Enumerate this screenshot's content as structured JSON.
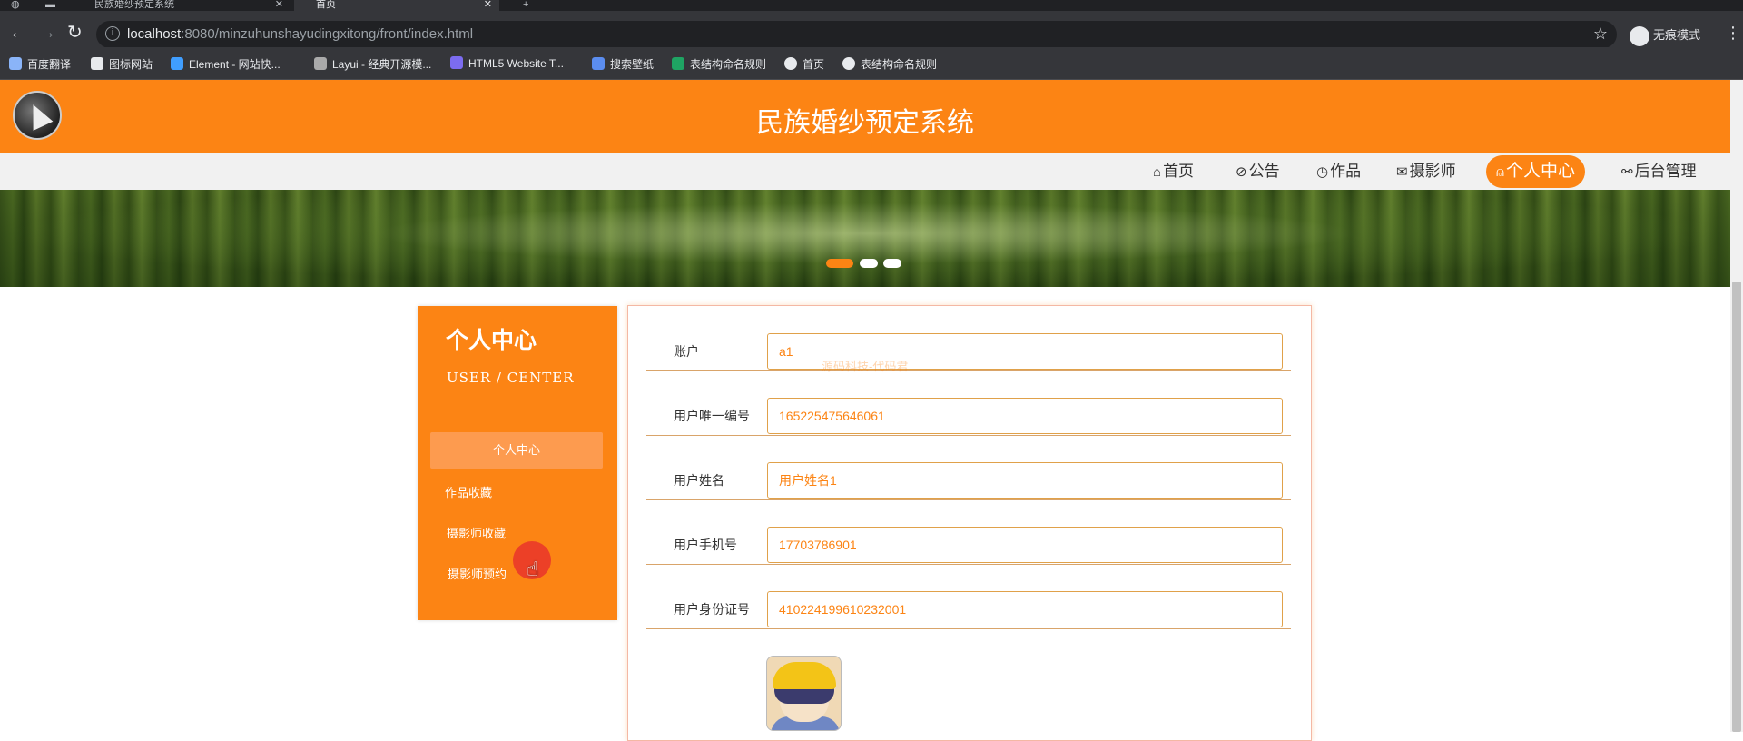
{
  "browser": {
    "tabs": [
      {
        "label": "",
        "active": false
      },
      {
        "label": "民族婚纱预定系统",
        "active": false
      },
      {
        "label": "首页",
        "active": true
      }
    ],
    "new_tab": "+",
    "url_host": "localhost",
    "url_rest": ":8080/minzuhunshayudingxitong/front/index.html",
    "incognito_label": "无痕模式",
    "bookmarks": [
      "百度翻译",
      "图标网站",
      "Element - 网站快...",
      "Layui - 经典开源模...",
      "HTML5 Website T...",
      "搜索壁纸",
      "表结构命名规则",
      "首页",
      "表结构命名规则"
    ]
  },
  "site": {
    "title": "民族婚纱预定系统",
    "nav": [
      {
        "icon": "⌂",
        "label": "首页"
      },
      {
        "icon": "⊘",
        "label": "公告"
      },
      {
        "icon": "◷",
        "label": "作品"
      },
      {
        "icon": "✉",
        "label": "摄影师"
      },
      {
        "icon": "⍝",
        "label": "个人中心",
        "active": true
      },
      {
        "icon": "⚯",
        "label": "后台管理"
      }
    ],
    "carousel_active_index": 0
  },
  "sidebar": {
    "title": "个人中心",
    "subtitle": "USER / CENTER",
    "items": [
      "个人中心",
      "作品收藏",
      "摄影师收藏",
      "摄影师预约"
    ]
  },
  "form": {
    "watermark": "源码科技-代码君",
    "fields": [
      {
        "label": "账户",
        "value": "a1"
      },
      {
        "label": "用户唯一编号",
        "value": "165225475646061"
      },
      {
        "label": "用户姓名",
        "value": "用户姓名1"
      },
      {
        "label": "用户手机号",
        "value": "17703786901"
      },
      {
        "label": "用户身份证号",
        "value": "410224199610232001"
      }
    ]
  },
  "colors": {
    "brand": "#fc8414",
    "nav_bg": "#f1f1f1"
  }
}
